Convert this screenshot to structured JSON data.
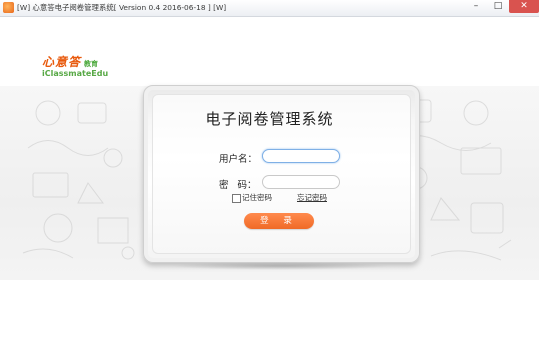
{
  "window": {
    "title": "[W] 心意答电子阅卷管理系统[ Version 0.4 2016-06-18 ] [W]",
    "controls": {
      "minimize": "–",
      "restore": "□",
      "close": "✕"
    }
  },
  "logo": {
    "name_cn": "心意答",
    "sub_cn": "教育",
    "name_en": "iClassmateEdu"
  },
  "login": {
    "system_title": "电子阅卷管理系统",
    "username_label": "用户名：",
    "username_value": "",
    "password_label": "密   码：",
    "password_value": "",
    "remember_label": "记住密码",
    "remember_checked": false,
    "forgot_label": "忘记密码",
    "login_button": "登 录"
  },
  "colors": {
    "accent": "#f06a26",
    "logo_orange": "#e8590c",
    "logo_green": "#57a845",
    "focus_border": "#7fb0e6"
  },
  "icons": [
    "app-icon",
    "minimize-icon",
    "restore-icon",
    "close-icon"
  ]
}
